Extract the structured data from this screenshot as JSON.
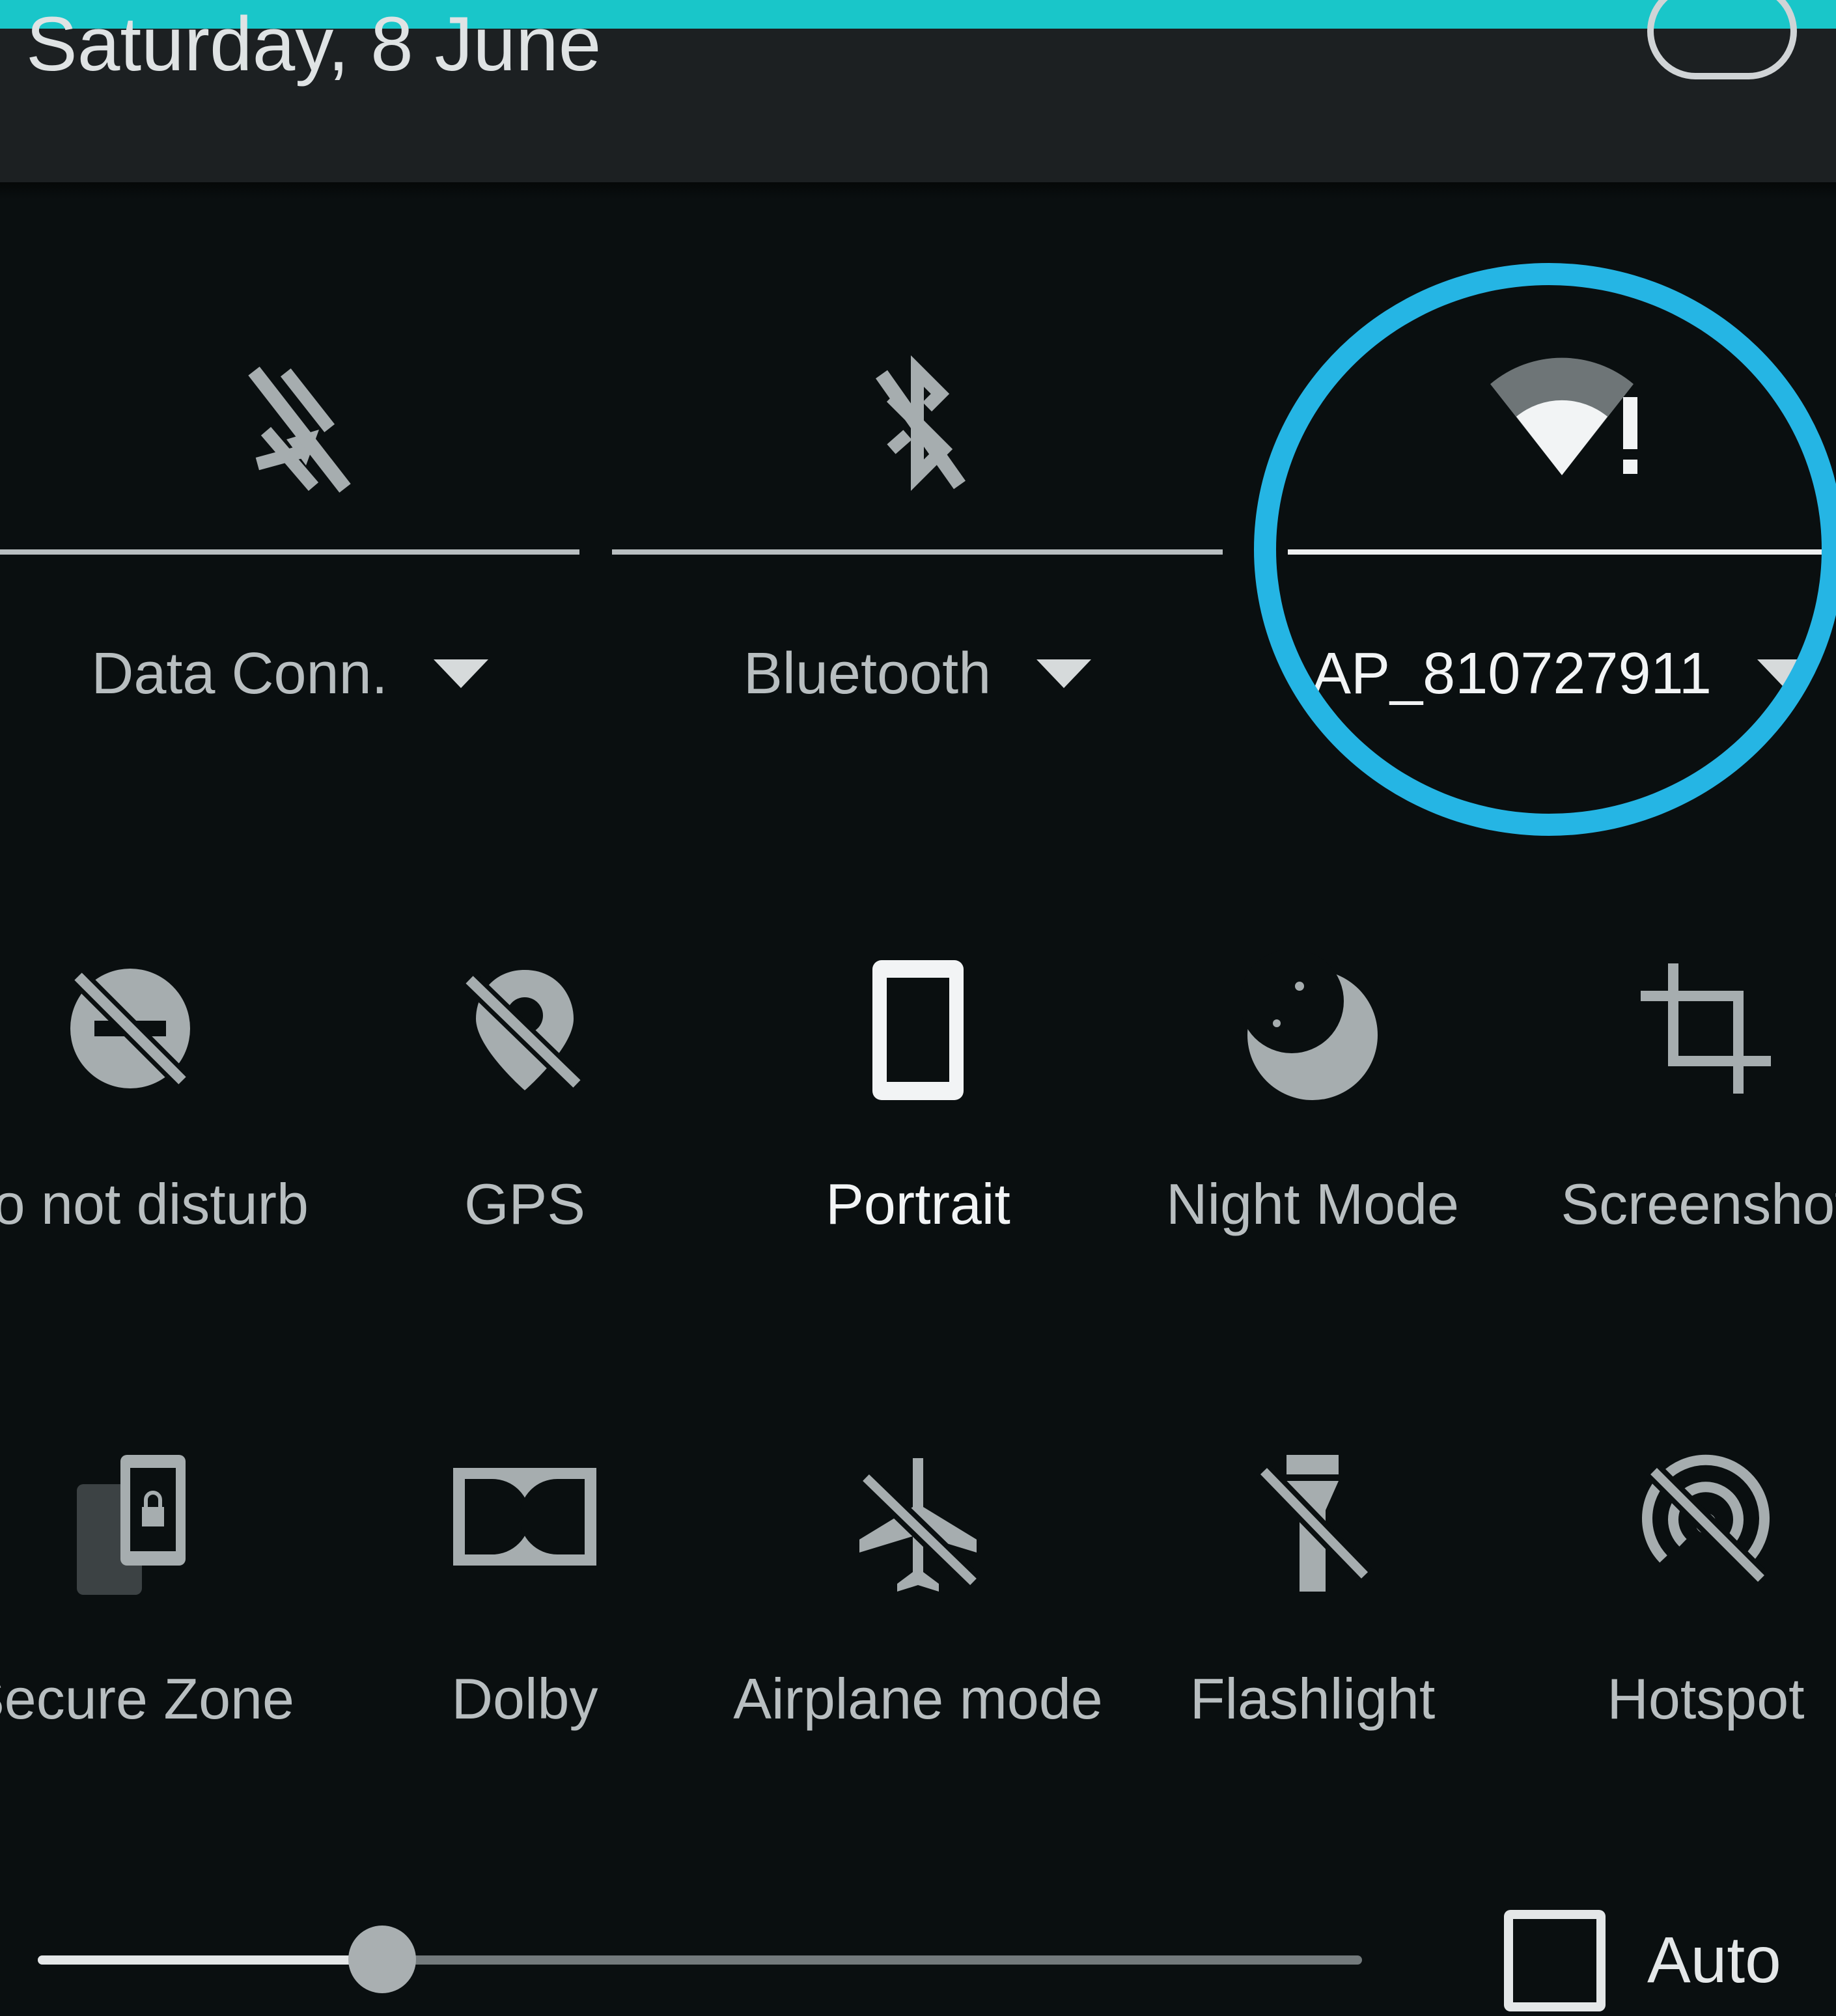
{
  "header": {
    "date": "Saturday, 8 June"
  },
  "connections": [
    {
      "label": "Data Conn.",
      "icon": "mobile-data-off-icon",
      "enabled": false
    },
    {
      "label": "Bluetooth",
      "icon": "bluetooth-off-icon",
      "enabled": false
    },
    {
      "label": "AP_810727911",
      "icon": "wifi-no-internet-icon",
      "enabled": true,
      "highlighted": true
    }
  ],
  "tiles": [
    [
      {
        "label": "Do not disturb",
        "icon": "do-not-disturb-off-icon",
        "active": false
      },
      {
        "label": "GPS",
        "icon": "location-off-icon",
        "active": false
      },
      {
        "label": "Portrait",
        "icon": "portrait-lock-icon",
        "active": true
      },
      {
        "label": "Night Mode",
        "icon": "moon-icon",
        "active": false
      },
      {
        "label": "Screenshot",
        "icon": "crop-icon",
        "active": false
      }
    ],
    [
      {
        "label": "Secure Zone",
        "icon": "secure-zone-lock-icon",
        "active": false
      },
      {
        "label": "Dolby",
        "icon": "dolby-icon",
        "active": false
      },
      {
        "label": "Airplane mode",
        "icon": "airplane-off-icon",
        "active": false
      },
      {
        "label": "Flashlight",
        "icon": "flashlight-off-icon",
        "active": false
      },
      {
        "label": "Hotspot",
        "icon": "hotspot-off-icon",
        "active": false
      }
    ]
  ],
  "brightness": {
    "level": 0.26,
    "auto_label": "Auto",
    "auto_checked": false
  },
  "colors": {
    "accent_strip": "#19c6c9",
    "highlight_ring": "#25b5e4",
    "panel_background": "#0a0f10"
  }
}
